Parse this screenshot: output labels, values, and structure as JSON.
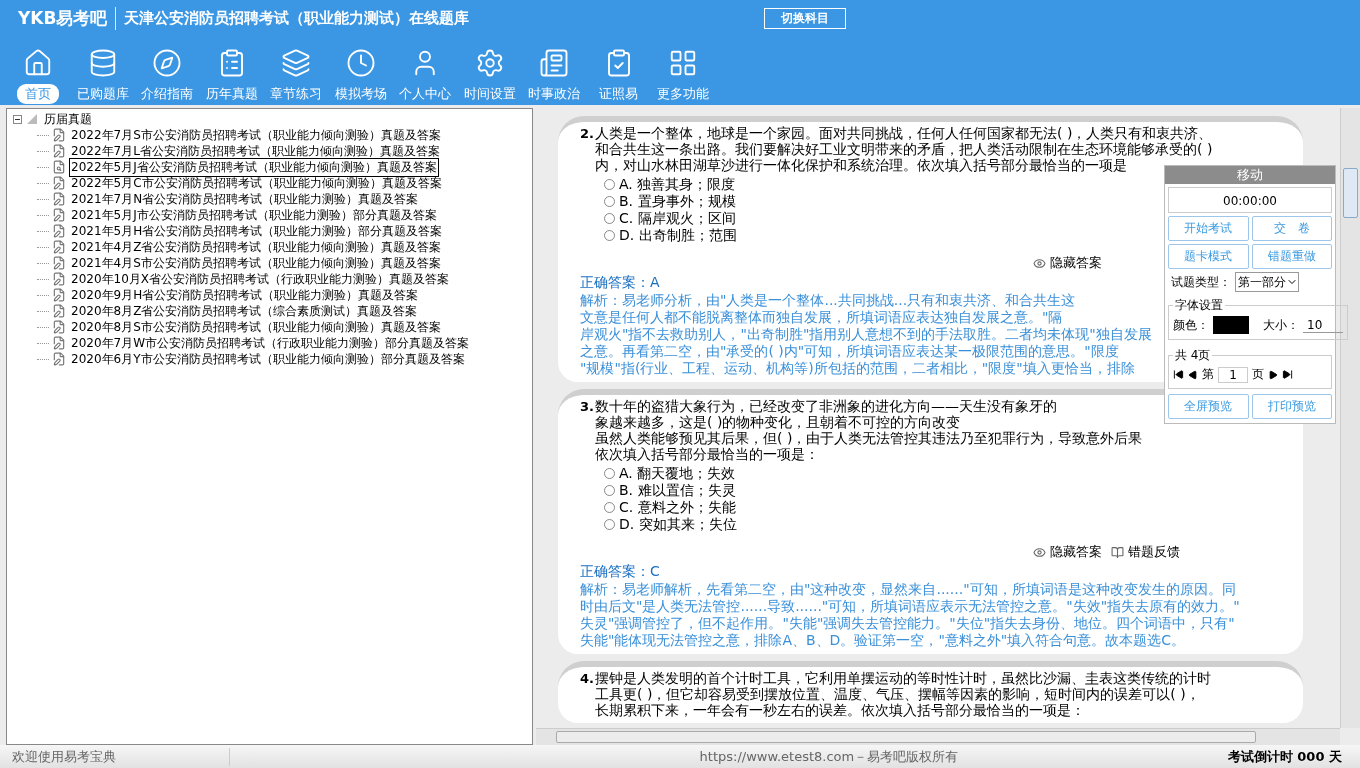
{
  "header": {
    "logo": "YKB易考吧",
    "title": "天津公安消防员招聘考试（职业能力测试）在线题库",
    "switch_button": "切换科目"
  },
  "nav": [
    {
      "label": "首页",
      "selected": true
    },
    {
      "label": "已购题库",
      "selected": false
    },
    {
      "label": "介绍指南",
      "selected": false
    },
    {
      "label": "历年真题",
      "selected": false
    },
    {
      "label": "章节练习",
      "selected": false
    },
    {
      "label": "模拟考场",
      "selected": false
    },
    {
      "label": "个人中心",
      "selected": false
    },
    {
      "label": "时间设置",
      "selected": false
    },
    {
      "label": "时事政治",
      "selected": false
    },
    {
      "label": "证照易",
      "selected": false
    },
    {
      "label": "更多功能",
      "selected": false
    }
  ],
  "tree": {
    "root": "历届真题",
    "expanded": true,
    "children": [
      {
        "label": "2022年7月S市公安消防员招聘考试（职业能力倾向测验）真题及答案",
        "selected": false
      },
      {
        "label": "2022年7月L省公安消防员招聘考试（职业能力倾向测验）真题及答案",
        "selected": false
      },
      {
        "label": "2022年5月J省公安消防员招聘考试（职业能力倾向测验）真题及答案",
        "selected": true
      },
      {
        "label": "2022年5月C市公安消防员招聘考试（职业能力倾向测验）真题及答案",
        "selected": false
      },
      {
        "label": "2021年7月N省公安消防员招聘考试（职业能力测验）真题及答案",
        "selected": false
      },
      {
        "label": "2021年5月J市公安消防员招聘考试（职业能力测验）部分真题及答案",
        "selected": false
      },
      {
        "label": "2021年5月H省公安消防员招聘考试（职业能力测验）部分真题及答案",
        "selected": false
      },
      {
        "label": "2021年4月Z省公安消防员招聘考试（职业能力倾向测验）真题及答案",
        "selected": false
      },
      {
        "label": "2021年4月S市公安消防员招聘考试（职业能力倾向测验）真题及答案",
        "selected": false
      },
      {
        "label": "2020年10月X省公安消防员招聘考试（行政职业能力测验）真题及答案",
        "selected": false
      },
      {
        "label": "2020年9月H省公安消防员招聘考试（职业能力测验）真题及答案",
        "selected": false
      },
      {
        "label": "2020年8月Z省公安消防员招聘考试（综合素质测试）真题及答案",
        "selected": false
      },
      {
        "label": "2020年8月S市公安消防员招聘考试（职业能力倾向测验）真题及答案",
        "selected": false
      },
      {
        "label": "2020年7月W市公安消防员招聘考试（行政职业能力测验）部分真题及答案",
        "selected": false
      },
      {
        "label": "2020年6月Y市公安消防员招聘考试（职业能力倾向测验）部分真题及答案",
        "selected": false
      }
    ]
  },
  "questions": [
    {
      "number": "2.",
      "lines": [
        "人类是一个整体，地球是一个家园。面对共同挑战，任何人任何国家都无法( )，人类只有和衷共济、",
        "和合共生这一条出路。我们要解决好工业文明带来的矛盾，把人类活动限制在生态环境能够承受的( )",
        "内，对山水林田湖草沙进行一体化保护和系统治理。依次填入括号部分最恰当的一项是"
      ],
      "options": [
        {
          "label": "A. 独善其身；限度",
          "selected": false
        },
        {
          "label": "B. 置身事外；规模",
          "selected": false
        },
        {
          "label": "C. 隔岸观火；区间",
          "selected": false
        },
        {
          "label": "D. 出奇制胜；范围",
          "selected": false
        }
      ],
      "actions": [
        {
          "kind": "hide",
          "label": "隐藏答案"
        }
      ],
      "answer": "正确答案：A",
      "analysis": [
        "解析：易老师分析，由\"人类是一个整体...共同挑战...只有和衷共济、和合共生这",
        "文意是任何人都不能脱离整体而独自发展，所填词语应表达独自发展之意。\"隔",
        "岸观火\"指不去救助别人，\"出奇制胜\"指用别人意想不到的手法取胜。二者均未体现\"独自发展",
        "之意。再看第二空，由\"承受的( )内\"可知，所填词语应表达某一极限范围的意思。\"限度",
        "\"规模\"指(行业、工程、运动、机构等)所包括的范围，二者相比，\"限度\"填入更恰当，排除"
      ]
    },
    {
      "number": "3.",
      "lines": [
        "数十年的盗猎大象行为，已经改变了非洲象的进化方向——天生没有象牙的",
        "象越来越多，这是( )的物种变化，且朝着不可控的方向改变",
        "虽然人类能够预见其后果，但( )，由于人类无法管控其违法乃至犯罪行为，导致意外后果",
        "依次填入括号部分最恰当的一项是："
      ],
      "options": [
        {
          "label": "A. 翻天覆地；失效",
          "selected": false
        },
        {
          "label": "B. 难以置信；失灵",
          "selected": false
        },
        {
          "label": "C. 意料之外；失能",
          "selected": false
        },
        {
          "label": "D. 突如其来；失位",
          "selected": false
        }
      ],
      "actions": [
        {
          "kind": "hide",
          "label": "隐藏答案"
        },
        {
          "kind": "feedback",
          "label": "错题反馈"
        }
      ],
      "answer": "正确答案：C",
      "analysis": [
        "解析：易老师解析，先看第二空，由\"这种改变，显然来自......\"可知，所填词语是这种改变发生的原因。同",
        "时由后文\"是人类无法管控......导致......\"可知，所填词语应表示无法管控之意。\"失效\"指失去原有的效力。\"",
        "失灵\"强调管控了，但不起作用。\"失能\"强调失去管控能力。\"失位\"指失去身份、地位。四个词语中，只有\"",
        "失能\"能体现无法管控之意，排除A、B、D。验证第一空，\"意料之外\"填入符合句意。故本题选C。"
      ]
    },
    {
      "number": "4.",
      "lines": [
        "摆钟是人类发明的首个计时工具，它利用单摆运动的等时性计时，虽然比沙漏、圭表这类传统的计时",
        "工具更( )，但它却容易受到摆放位置、温度、气压、摆幅等因素的影响，短时间内的误差可以( )，",
        "长期累积下来，一年会有一秒左右的误差。依次填入括号部分最恰当的一项是："
      ]
    }
  ],
  "panel": {
    "title": "移动",
    "timer": "00:00:00",
    "buttons": [
      "开始考试",
      "交　卷",
      "题卡模式",
      "错题重做"
    ],
    "type_label": "试题类型：",
    "type_value": "第一部分",
    "font_group": "字体设置",
    "color_label": "颜色：",
    "color": "#000000",
    "size_label": "大小：",
    "size_value": "10",
    "pages": "共 4页",
    "page_prefix": "第",
    "page_value": "1",
    "page_suffix": "页",
    "bottom_buttons": [
      "全屏预览",
      "打印预览"
    ]
  },
  "status_bar": {
    "welcome": "欢迎使用易考宝典",
    "copyright": "https://www.etest8.com－易考吧版权所有",
    "countdown": "考试倒计时 000 天"
  }
}
